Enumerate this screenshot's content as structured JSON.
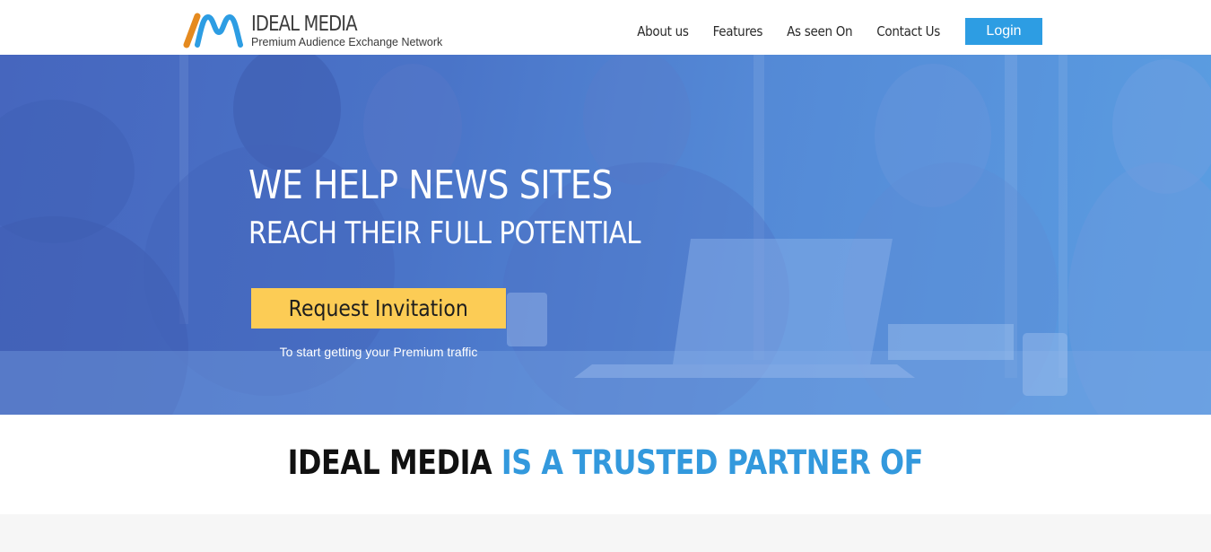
{
  "header": {
    "logo": {
      "title": "IDEAL MEDIA",
      "tagline": "Premium Audience Exchange Network",
      "icon": "ideal-media-logo-icon",
      "colors": {
        "orange": "#e58a1f",
        "blue": "#2d9de3"
      }
    },
    "nav": [
      {
        "label": "About us"
      },
      {
        "label": "Features"
      },
      {
        "label": "As seen On"
      },
      {
        "label": "Contact Us"
      }
    ],
    "login_label": "Login",
    "login_color": "#2d9de3"
  },
  "hero": {
    "title": "WE HELP NEWS SITES",
    "subtitle": "REACH THEIR FULL POTENTIAL",
    "cta_label": "Request Invitation",
    "cta_color": "#fccc55",
    "cta_note": "To start getting your Premium traffic",
    "overlay_color": "#4a74c8"
  },
  "partner": {
    "brand": "IDEAL MEDIA",
    "rest": "IS A TRUSTED PARTNER OF",
    "accent_color": "#3399dd"
  }
}
